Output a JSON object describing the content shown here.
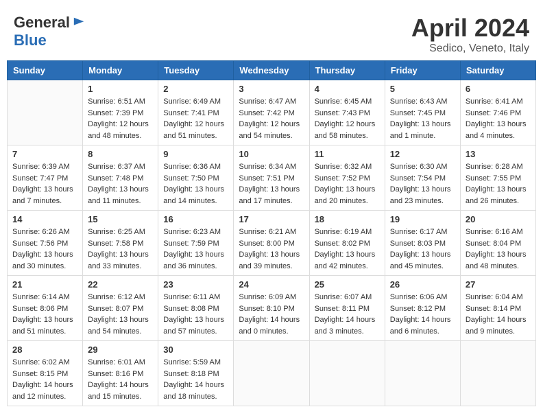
{
  "header": {
    "logo_general": "General",
    "logo_blue": "Blue",
    "title": "April 2024",
    "subtitle": "Sedico, Veneto, Italy"
  },
  "columns": [
    "Sunday",
    "Monday",
    "Tuesday",
    "Wednesday",
    "Thursday",
    "Friday",
    "Saturday"
  ],
  "weeks": [
    [
      {
        "day": "",
        "lines": []
      },
      {
        "day": "1",
        "lines": [
          "Sunrise: 6:51 AM",
          "Sunset: 7:39 PM",
          "Daylight: 12 hours",
          "and 48 minutes."
        ]
      },
      {
        "day": "2",
        "lines": [
          "Sunrise: 6:49 AM",
          "Sunset: 7:41 PM",
          "Daylight: 12 hours",
          "and 51 minutes."
        ]
      },
      {
        "day": "3",
        "lines": [
          "Sunrise: 6:47 AM",
          "Sunset: 7:42 PM",
          "Daylight: 12 hours",
          "and 54 minutes."
        ]
      },
      {
        "day": "4",
        "lines": [
          "Sunrise: 6:45 AM",
          "Sunset: 7:43 PM",
          "Daylight: 12 hours",
          "and 58 minutes."
        ]
      },
      {
        "day": "5",
        "lines": [
          "Sunrise: 6:43 AM",
          "Sunset: 7:45 PM",
          "Daylight: 13 hours",
          "and 1 minute."
        ]
      },
      {
        "day": "6",
        "lines": [
          "Sunrise: 6:41 AM",
          "Sunset: 7:46 PM",
          "Daylight: 13 hours",
          "and 4 minutes."
        ]
      }
    ],
    [
      {
        "day": "7",
        "lines": [
          "Sunrise: 6:39 AM",
          "Sunset: 7:47 PM",
          "Daylight: 13 hours",
          "and 7 minutes."
        ]
      },
      {
        "day": "8",
        "lines": [
          "Sunrise: 6:37 AM",
          "Sunset: 7:48 PM",
          "Daylight: 13 hours",
          "and 11 minutes."
        ]
      },
      {
        "day": "9",
        "lines": [
          "Sunrise: 6:36 AM",
          "Sunset: 7:50 PM",
          "Daylight: 13 hours",
          "and 14 minutes."
        ]
      },
      {
        "day": "10",
        "lines": [
          "Sunrise: 6:34 AM",
          "Sunset: 7:51 PM",
          "Daylight: 13 hours",
          "and 17 minutes."
        ]
      },
      {
        "day": "11",
        "lines": [
          "Sunrise: 6:32 AM",
          "Sunset: 7:52 PM",
          "Daylight: 13 hours",
          "and 20 minutes."
        ]
      },
      {
        "day": "12",
        "lines": [
          "Sunrise: 6:30 AM",
          "Sunset: 7:54 PM",
          "Daylight: 13 hours",
          "and 23 minutes."
        ]
      },
      {
        "day": "13",
        "lines": [
          "Sunrise: 6:28 AM",
          "Sunset: 7:55 PM",
          "Daylight: 13 hours",
          "and 26 minutes."
        ]
      }
    ],
    [
      {
        "day": "14",
        "lines": [
          "Sunrise: 6:26 AM",
          "Sunset: 7:56 PM",
          "Daylight: 13 hours",
          "and 30 minutes."
        ]
      },
      {
        "day": "15",
        "lines": [
          "Sunrise: 6:25 AM",
          "Sunset: 7:58 PM",
          "Daylight: 13 hours",
          "and 33 minutes."
        ]
      },
      {
        "day": "16",
        "lines": [
          "Sunrise: 6:23 AM",
          "Sunset: 7:59 PM",
          "Daylight: 13 hours",
          "and 36 minutes."
        ]
      },
      {
        "day": "17",
        "lines": [
          "Sunrise: 6:21 AM",
          "Sunset: 8:00 PM",
          "Daylight: 13 hours",
          "and 39 minutes."
        ]
      },
      {
        "day": "18",
        "lines": [
          "Sunrise: 6:19 AM",
          "Sunset: 8:02 PM",
          "Daylight: 13 hours",
          "and 42 minutes."
        ]
      },
      {
        "day": "19",
        "lines": [
          "Sunrise: 6:17 AM",
          "Sunset: 8:03 PM",
          "Daylight: 13 hours",
          "and 45 minutes."
        ]
      },
      {
        "day": "20",
        "lines": [
          "Sunrise: 6:16 AM",
          "Sunset: 8:04 PM",
          "Daylight: 13 hours",
          "and 48 minutes."
        ]
      }
    ],
    [
      {
        "day": "21",
        "lines": [
          "Sunrise: 6:14 AM",
          "Sunset: 8:06 PM",
          "Daylight: 13 hours",
          "and 51 minutes."
        ]
      },
      {
        "day": "22",
        "lines": [
          "Sunrise: 6:12 AM",
          "Sunset: 8:07 PM",
          "Daylight: 13 hours",
          "and 54 minutes."
        ]
      },
      {
        "day": "23",
        "lines": [
          "Sunrise: 6:11 AM",
          "Sunset: 8:08 PM",
          "Daylight: 13 hours",
          "and 57 minutes."
        ]
      },
      {
        "day": "24",
        "lines": [
          "Sunrise: 6:09 AM",
          "Sunset: 8:10 PM",
          "Daylight: 14 hours",
          "and 0 minutes."
        ]
      },
      {
        "day": "25",
        "lines": [
          "Sunrise: 6:07 AM",
          "Sunset: 8:11 PM",
          "Daylight: 14 hours",
          "and 3 minutes."
        ]
      },
      {
        "day": "26",
        "lines": [
          "Sunrise: 6:06 AM",
          "Sunset: 8:12 PM",
          "Daylight: 14 hours",
          "and 6 minutes."
        ]
      },
      {
        "day": "27",
        "lines": [
          "Sunrise: 6:04 AM",
          "Sunset: 8:14 PM",
          "Daylight: 14 hours",
          "and 9 minutes."
        ]
      }
    ],
    [
      {
        "day": "28",
        "lines": [
          "Sunrise: 6:02 AM",
          "Sunset: 8:15 PM",
          "Daylight: 14 hours",
          "and 12 minutes."
        ]
      },
      {
        "day": "29",
        "lines": [
          "Sunrise: 6:01 AM",
          "Sunset: 8:16 PM",
          "Daylight: 14 hours",
          "and 15 minutes."
        ]
      },
      {
        "day": "30",
        "lines": [
          "Sunrise: 5:59 AM",
          "Sunset: 8:18 PM",
          "Daylight: 14 hours",
          "and 18 minutes."
        ]
      },
      {
        "day": "",
        "lines": []
      },
      {
        "day": "",
        "lines": []
      },
      {
        "day": "",
        "lines": []
      },
      {
        "day": "",
        "lines": []
      }
    ]
  ]
}
